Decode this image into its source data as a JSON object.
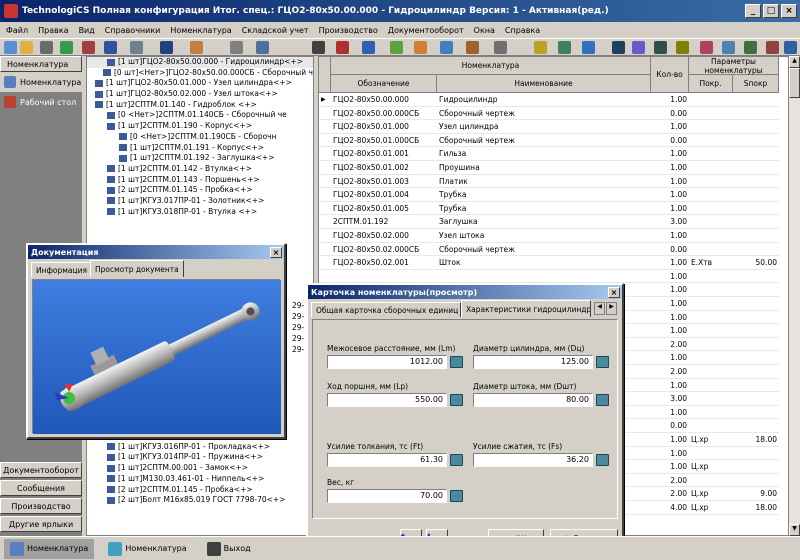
{
  "window": {
    "title": "TechnologiCS Полная конфигурация Итог. спец.: ГЦО2-80х50.00.000 - Гидроцилиндр Версия: 1 - Активная(ред.)"
  },
  "menu": [
    "Файл",
    "Правка",
    "Вид",
    "Справочники",
    "Номенклатура",
    "Складской учет",
    "Производство",
    "Документооборот",
    "Окна",
    "Справка"
  ],
  "left_panel": {
    "header": "Номенклатура",
    "items": [
      "Номенклатура",
      "Рабочий стол"
    ],
    "bottom_buttons": [
      "Документооборот",
      "Сообщения",
      "Производство",
      "Другие ярлыки"
    ]
  },
  "tree": [
    "[1 шт]ГЦО2-80х50.00.000 - Гидроцилиндр<+>",
    "[0 шт]<Нет>]ГЦО2-80х50.00.000СБ - Сборочный че",
    "[1 шт]ГЦО2-80х50.01.000 - Узел цилиндра<+>",
    "[1 шт]ГЦО2-80х50.02.000 - Узел штока<+>",
    "[1 шт]2СПТМ.01.140 - Гидроблок <+>",
    "[0 <Нет>]2СПТМ.01.140СБ - Сборочный че",
    "[1 шт]2СПТМ.01.190 - Корпус<+>",
    "[0 <Нет>]2СПТМ.01.190СБ - Сборочн",
    "[1 шт]2СПТМ.01.191 - Корпус<+>",
    "[1 шт]2СПТМ.01.192 - Заглушка<+>",
    "[1 шт]2СПТМ.01.142 - Втулка<+>",
    "[1 шт]2СПТМ.01.143 - Поршень<+>",
    "[2 шт]2СПТМ.01.145 - Пробка<+>",
    "[1 шт]КГУЗ.017ПР-01 - Золотник<+>",
    "[1 шт]КГУЗ.018ПР-01 - Втулка <+>",
    "",
    "",
    "",
    "",
    "",
    "",
    "",
    "",
    "",
    "",
    "",
    "",
    "",
    "",
    "",
    "",
    "",
    "",
    "",
    "",
    "[1 шт]КГУЗ.022ПР-01 - Пружина<+>",
    "[1 шт]КГУЗ.016ПР-01 - Прокладка<+>",
    "[1 шт]КГУЗ.014ПР-01 - Пружина<+>",
    "[1 шт]2СПТМ.00.001 - Замок<+>",
    "[1 шт]М130.03.461-01 - Ниппель<+>",
    "[2 шт]2СПТМ.01.145 - Пробка<+>",
    "[2 шт]Болт М16х85.019 ГОСТ 7798-70<+>"
  ],
  "tree_side_fragments": [
    "29-",
    "29-",
    "29-",
    "29-",
    "29-"
  ],
  "grid": {
    "headers": {
      "group": "Номенклатура",
      "code": "Обозначение",
      "name": "Наименование",
      "qty": "Кол-во",
      "params": "Параметры номенклатуры",
      "pokr": "Покр.",
      "spokr": "Sпокр"
    },
    "rows": [
      {
        "code": "ГЦО2-80х50.00.000",
        "name": "Гидроцилиндр",
        "qty": "1.00",
        "pokr": "",
        "spokr": ""
      },
      {
        "code": "ГЦО2-80х50.00.000СБ",
        "name": "Сборочный чертеж",
        "qty": "0.00",
        "pokr": "",
        "spokr": ""
      },
      {
        "code": "ГЦО2-80х50.01.000",
        "name": "Узел цилиндра",
        "qty": "1.00",
        "pokr": "",
        "spokr": ""
      },
      {
        "code": "ГЦО2-80х50.01.000СБ",
        "name": "Сборочный чертеж",
        "qty": "0.00",
        "pokr": "",
        "spokr": ""
      },
      {
        "code": "ГЦО2-80х50.01.001",
        "name": "Гильза",
        "qty": "1.00",
        "pokr": "",
        "spokr": ""
      },
      {
        "code": "ГЦО2-80х50.01.002",
        "name": "Проушина",
        "qty": "1.00",
        "pokr": "",
        "spokr": ""
      },
      {
        "code": "ГЦО2-80х50.01.003",
        "name": "Платик",
        "qty": "1.00",
        "pokr": "",
        "spokr": ""
      },
      {
        "code": "ГЦО2-80х50.01.004",
        "name": "Трубка",
        "qty": "1.00",
        "pokr": "",
        "spokr": ""
      },
      {
        "code": "ГЦО2-80х50.01.005",
        "name": "Трубка",
        "qty": "1.00",
        "pokr": "",
        "spokr": ""
      },
      {
        "code": "2СПТМ.01.192",
        "name": "Заглушка",
        "qty": "3.00",
        "pokr": "",
        "spokr": ""
      },
      {
        "code": "ГЦО2-80х50.02.000",
        "name": "Узел штока",
        "qty": "1.00",
        "pokr": "",
        "spokr": ""
      },
      {
        "code": "ГЦО2-80х50.02.000СБ",
        "name": "Сборочный чертеж",
        "qty": "0.00",
        "pokr": "",
        "spokr": ""
      },
      {
        "code": "ГЦО2-80х50.02.001",
        "name": "Шток",
        "qty": "1.00",
        "pokr": "Е.Хтв",
        "spokr": "50.00"
      },
      {
        "code": "",
        "name": "",
        "qty": "1.00",
        "pokr": "",
        "spokr": ""
      },
      {
        "code": "",
        "name": "",
        "qty": "1.00",
        "pokr": "",
        "spokr": ""
      },
      {
        "code": "",
        "name": "",
        "qty": "1.00",
        "pokr": "",
        "spokr": ""
      },
      {
        "code": "",
        "name": "",
        "qty": "1.00",
        "pokr": "",
        "spokr": ""
      },
      {
        "code": "",
        "name": "",
        "qty": "1.00",
        "pokr": "",
        "spokr": ""
      },
      {
        "code": "2290-",
        "name": "",
        "qty": "2.00",
        "pokr": "",
        "spokr": ""
      },
      {
        "code": "290-",
        "name": "",
        "qty": "1.00",
        "pokr": "",
        "spokr": ""
      },
      {
        "code": "2290-0",
        "name": "",
        "qty": "2.00",
        "pokr": "",
        "spokr": ""
      },
      {
        "code": "290-",
        "name": "",
        "qty": "1.00",
        "pokr": "",
        "spokr": ""
      },
      {
        "code": "2000",
        "name": "",
        "qty": "3.00",
        "pokr": "",
        "spokr": ""
      },
      {
        "code": "",
        "name": "",
        "qty": "1.00",
        "pokr": "",
        "spokr": ""
      },
      {
        "code": "",
        "name": "",
        "qty": "0.00",
        "pokr": "",
        "spokr": ""
      },
      {
        "code": "",
        "name": "",
        "qty": "1.00",
        "pokr": "Ц.хр",
        "spokr": "18.00"
      },
      {
        "code": "",
        "name": "",
        "qty": "1.00",
        "pokr": "",
        "spokr": ""
      },
      {
        "code": "",
        "name": "",
        "qty": "1.00",
        "pokr": "Ц.хр",
        "spokr": ""
      },
      {
        "code": "",
        "name": "",
        "qty": "2.00",
        "pokr": "",
        "spokr": ""
      },
      {
        "code": "",
        "name": "",
        "qty": "2.00",
        "pokr": "Ц.хр",
        "spokr": "9.00"
      },
      {
        "code": "",
        "name": "",
        "qty": "4.00",
        "pokr": "Ц.хр",
        "spokr": "18.00"
      }
    ]
  },
  "doc_dialog": {
    "title": "Документация",
    "tabs": [
      "Информация",
      "Просмотр документа"
    ]
  },
  "card_dialog": {
    "title": "Карточка номенклатуры(просмотр)",
    "tabs": [
      "Общая карточка сборочных единиц",
      "Характеристики гидроцилиндра"
    ],
    "fields": {
      "lm": {
        "label": "Межосевое расстояние, мм (Lm)",
        "value": "1012.00"
      },
      "dc": {
        "label": "Диаметр цилиндра, мм (Dц)",
        "value": "125.00"
      },
      "lp": {
        "label": "Ход поршня, мм (Lp)",
        "value": "550.00"
      },
      "dsh": {
        "label": "Диаметр штока, мм (Dшт)",
        "value": "80.00"
      },
      "ft": {
        "label": "Усилие толкания, тс (Ft)",
        "value": "61.30"
      },
      "fs": {
        "label": "Усилие сжатия, тс (Fs)",
        "value": "36.20"
      },
      "w": {
        "label": "Вес, кг",
        "value": "70.00"
      }
    },
    "buttons": {
      "ok": "OK",
      "cancel": "Отмена"
    }
  },
  "taskbar": [
    "Номенклатура",
    "Номенклатура",
    "Выход"
  ]
}
